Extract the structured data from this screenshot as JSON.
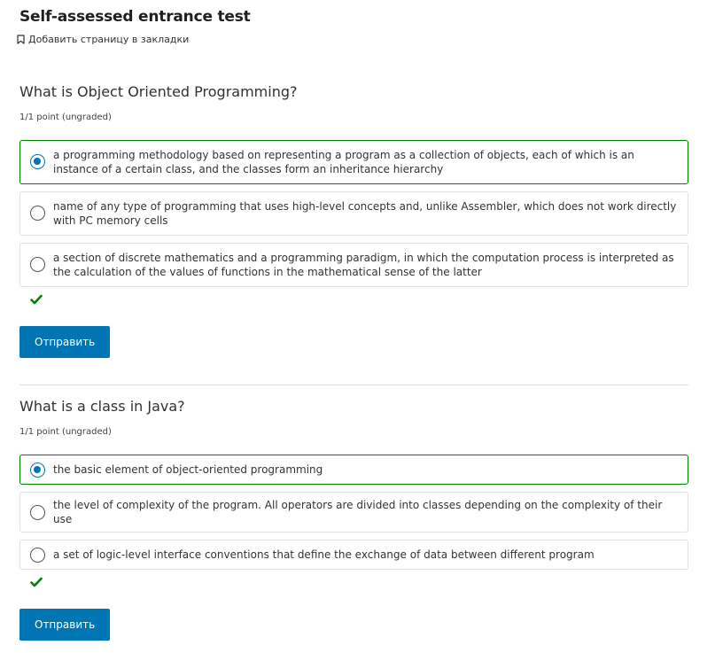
{
  "page": {
    "title": "Self-assessed entrance test",
    "bookmark_label": "Добавить страницу в закладки"
  },
  "questions": [
    {
      "text": "What is Object Oriented Programming?",
      "points": "1/1 point (ungraded)",
      "options": [
        {
          "label": "a programming methodology based on representing a program as a collection of objects, each of which is an instance of a certain class, and the classes form an inheritance hierarchy",
          "selected": true
        },
        {
          "label": "name of any type of programming that uses high-level concepts and, unlike Assembler, which does not work directly with PC memory cells",
          "selected": false
        },
        {
          "label": "a section of discrete mathematics and a programming paradigm, in which the computation process is interpreted as the calculation of the values of functions in the mathematical sense of the latter",
          "selected": false
        }
      ],
      "status": "correct",
      "submit_label": "Отправить"
    },
    {
      "text": "What is a class in Java?",
      "points": "1/1 point (ungraded)",
      "options": [
        {
          "label": "the basic element of object-oriented programming",
          "selected": true
        },
        {
          "label": "the level of complexity of the program. All operators are divided into classes depending on the complexity of their use",
          "selected": false
        },
        {
          "label": "a set of logic-level interface conventions that define the exchange of data between different program",
          "selected": false
        }
      ],
      "status": "correct",
      "submit_label": "Отправить"
    }
  ],
  "colors": {
    "accent": "#0075b4",
    "correct": "#008100",
    "border": "#e1e1e1"
  },
  "icons": {
    "bookmark": "bookmark-icon",
    "correct": "checkmark-icon"
  }
}
